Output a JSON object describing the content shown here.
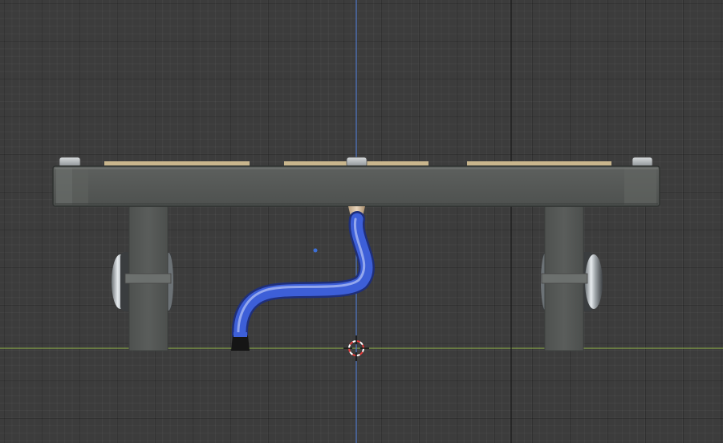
{
  "app": {
    "name": "3D Viewport",
    "view": "front-orthographic"
  },
  "colors": {
    "viewport_background": "#3c3c3c",
    "z_axis": "#4f78c8",
    "x_axis": "#8fb24a",
    "tube_blue": "#3d5fd8",
    "frame_gray": "#545755",
    "slat_wood": "#c9b68d",
    "cursor_red": "#e03a3a"
  },
  "scene": {
    "objects": [
      "top-beam",
      "wood-slat-left",
      "wood-slat-center",
      "wood-slat-right",
      "bolt-left",
      "bolt-center",
      "bolt-right",
      "leg-left",
      "leg-right",
      "wheel-left",
      "wheel-right",
      "nozzle",
      "blue-hose",
      "hose-end-cap",
      "origin-point"
    ]
  },
  "icons": {
    "cursor": "3d-cursor-icon"
  }
}
